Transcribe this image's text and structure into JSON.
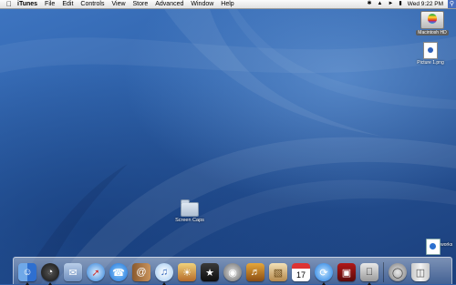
{
  "menubar": {
    "apple_icon": "apple-icon",
    "app_name": "iTunes",
    "menus": [
      "File",
      "Edit",
      "Controls",
      "View",
      "Store",
      "Advanced",
      "Window",
      "Help"
    ],
    "status_icons": [
      "bluetooth-icon",
      "wifi-icon",
      "volume-icon",
      "battery-icon"
    ],
    "clock": "Wed 9:22 PM",
    "spotlight_icon": "spotlight-icon"
  },
  "desktop": {
    "hard_drive_label": "Macintosh HD",
    "picture_file_label": "Picture 1.png",
    "folder_label": "Screen Caps",
    "app_label": "...works"
  },
  "dock": {
    "items": [
      {
        "name": "finder",
        "icon": "finder-icon",
        "running": true
      },
      {
        "name": "dashboard",
        "icon": "dashboard-icon",
        "running": true
      },
      {
        "name": "mail",
        "icon": "mail-icon",
        "running": false
      },
      {
        "name": "safari",
        "icon": "safari-icon",
        "running": false
      },
      {
        "name": "ichat",
        "icon": "ichat-icon",
        "running": false
      },
      {
        "name": "address-book",
        "icon": "address-book-icon",
        "running": false
      },
      {
        "name": "itunes",
        "icon": "itunes-icon",
        "running": true
      },
      {
        "name": "iphoto",
        "icon": "iphoto-icon",
        "running": false
      },
      {
        "name": "imovie",
        "icon": "imovie-icon",
        "running": false
      },
      {
        "name": "idvd",
        "icon": "idvd-icon",
        "running": false
      },
      {
        "name": "garageband",
        "icon": "garageband-icon",
        "running": false
      },
      {
        "name": "preview",
        "icon": "preview-icon",
        "running": false
      },
      {
        "name": "ical",
        "icon": "ical-icon",
        "running": false,
        "date": "17"
      },
      {
        "name": "sync",
        "icon": "sync-icon",
        "running": true
      },
      {
        "name": "photo-booth",
        "icon": "photo-booth-icon",
        "running": false
      },
      {
        "name": "system-preferences",
        "icon": "system-preferences-icon",
        "running": true
      },
      {
        "name": "quicktime",
        "icon": "quicktime-icon",
        "running": false
      },
      {
        "name": "trash",
        "icon": "trash-icon",
        "running": false
      }
    ]
  }
}
